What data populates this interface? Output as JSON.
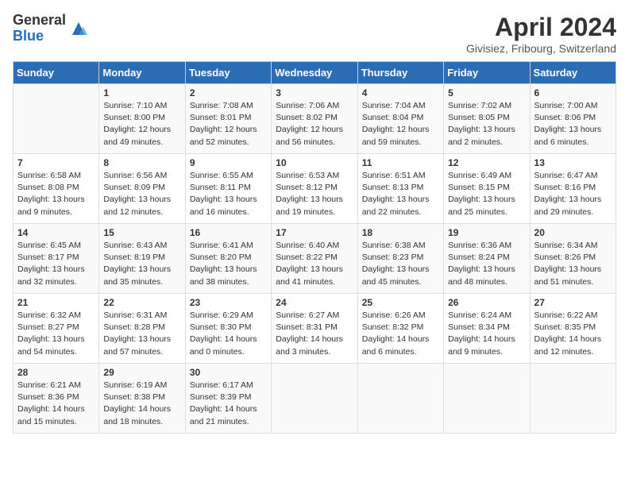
{
  "logo": {
    "general": "General",
    "blue": "Blue"
  },
  "title": "April 2024",
  "subtitle": "Givisiez, Fribourg, Switzerland",
  "days_header": [
    "Sunday",
    "Monday",
    "Tuesday",
    "Wednesday",
    "Thursday",
    "Friday",
    "Saturday"
  ],
  "weeks": [
    [
      {
        "day": "",
        "info": ""
      },
      {
        "day": "1",
        "info": "Sunrise: 7:10 AM\nSunset: 8:00 PM\nDaylight: 12 hours\nand 49 minutes."
      },
      {
        "day": "2",
        "info": "Sunrise: 7:08 AM\nSunset: 8:01 PM\nDaylight: 12 hours\nand 52 minutes."
      },
      {
        "day": "3",
        "info": "Sunrise: 7:06 AM\nSunset: 8:02 PM\nDaylight: 12 hours\nand 56 minutes."
      },
      {
        "day": "4",
        "info": "Sunrise: 7:04 AM\nSunset: 8:04 PM\nDaylight: 12 hours\nand 59 minutes."
      },
      {
        "day": "5",
        "info": "Sunrise: 7:02 AM\nSunset: 8:05 PM\nDaylight: 13 hours\nand 2 minutes."
      },
      {
        "day": "6",
        "info": "Sunrise: 7:00 AM\nSunset: 8:06 PM\nDaylight: 13 hours\nand 6 minutes."
      }
    ],
    [
      {
        "day": "7",
        "info": "Sunrise: 6:58 AM\nSunset: 8:08 PM\nDaylight: 13 hours\nand 9 minutes."
      },
      {
        "day": "8",
        "info": "Sunrise: 6:56 AM\nSunset: 8:09 PM\nDaylight: 13 hours\nand 12 minutes."
      },
      {
        "day": "9",
        "info": "Sunrise: 6:55 AM\nSunset: 8:11 PM\nDaylight: 13 hours\nand 16 minutes."
      },
      {
        "day": "10",
        "info": "Sunrise: 6:53 AM\nSunset: 8:12 PM\nDaylight: 13 hours\nand 19 minutes."
      },
      {
        "day": "11",
        "info": "Sunrise: 6:51 AM\nSunset: 8:13 PM\nDaylight: 13 hours\nand 22 minutes."
      },
      {
        "day": "12",
        "info": "Sunrise: 6:49 AM\nSunset: 8:15 PM\nDaylight: 13 hours\nand 25 minutes."
      },
      {
        "day": "13",
        "info": "Sunrise: 6:47 AM\nSunset: 8:16 PM\nDaylight: 13 hours\nand 29 minutes."
      }
    ],
    [
      {
        "day": "14",
        "info": "Sunrise: 6:45 AM\nSunset: 8:17 PM\nDaylight: 13 hours\nand 32 minutes."
      },
      {
        "day": "15",
        "info": "Sunrise: 6:43 AM\nSunset: 8:19 PM\nDaylight: 13 hours\nand 35 minutes."
      },
      {
        "day": "16",
        "info": "Sunrise: 6:41 AM\nSunset: 8:20 PM\nDaylight: 13 hours\nand 38 minutes."
      },
      {
        "day": "17",
        "info": "Sunrise: 6:40 AM\nSunset: 8:22 PM\nDaylight: 13 hours\nand 41 minutes."
      },
      {
        "day": "18",
        "info": "Sunrise: 6:38 AM\nSunset: 8:23 PM\nDaylight: 13 hours\nand 45 minutes."
      },
      {
        "day": "19",
        "info": "Sunrise: 6:36 AM\nSunset: 8:24 PM\nDaylight: 13 hours\nand 48 minutes."
      },
      {
        "day": "20",
        "info": "Sunrise: 6:34 AM\nSunset: 8:26 PM\nDaylight: 13 hours\nand 51 minutes."
      }
    ],
    [
      {
        "day": "21",
        "info": "Sunrise: 6:32 AM\nSunset: 8:27 PM\nDaylight: 13 hours\nand 54 minutes."
      },
      {
        "day": "22",
        "info": "Sunrise: 6:31 AM\nSunset: 8:28 PM\nDaylight: 13 hours\nand 57 minutes."
      },
      {
        "day": "23",
        "info": "Sunrise: 6:29 AM\nSunset: 8:30 PM\nDaylight: 14 hours\nand 0 minutes."
      },
      {
        "day": "24",
        "info": "Sunrise: 6:27 AM\nSunset: 8:31 PM\nDaylight: 14 hours\nand 3 minutes."
      },
      {
        "day": "25",
        "info": "Sunrise: 6:26 AM\nSunset: 8:32 PM\nDaylight: 14 hours\nand 6 minutes."
      },
      {
        "day": "26",
        "info": "Sunrise: 6:24 AM\nSunset: 8:34 PM\nDaylight: 14 hours\nand 9 minutes."
      },
      {
        "day": "27",
        "info": "Sunrise: 6:22 AM\nSunset: 8:35 PM\nDaylight: 14 hours\nand 12 minutes."
      }
    ],
    [
      {
        "day": "28",
        "info": "Sunrise: 6:21 AM\nSunset: 8:36 PM\nDaylight: 14 hours\nand 15 minutes."
      },
      {
        "day": "29",
        "info": "Sunrise: 6:19 AM\nSunset: 8:38 PM\nDaylight: 14 hours\nand 18 minutes."
      },
      {
        "day": "30",
        "info": "Sunrise: 6:17 AM\nSunset: 8:39 PM\nDaylight: 14 hours\nand 21 minutes."
      },
      {
        "day": "",
        "info": ""
      },
      {
        "day": "",
        "info": ""
      },
      {
        "day": "",
        "info": ""
      },
      {
        "day": "",
        "info": ""
      }
    ]
  ]
}
